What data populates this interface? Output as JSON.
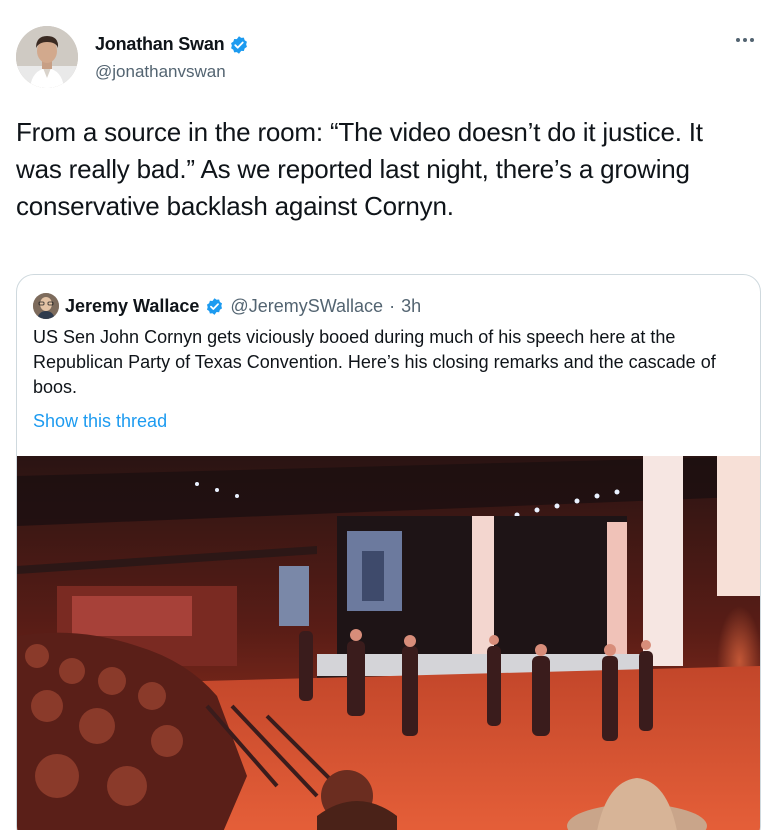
{
  "author": {
    "name": "Jonathan Swan",
    "handle": "@jonathanvswan",
    "verified_color": "#1d9bf0"
  },
  "more_icon": "ellipsis-icon",
  "tweet": {
    "text": "From a source in the room: “The video doesn’t do it justice. It was really bad.” As we reported last night, there’s a growing conservative backlash against Cornyn."
  },
  "quoted_tweet": {
    "author_name": "Jeremy Wallace",
    "handle": "@JeremySWallace",
    "separator": "·",
    "time": "3h",
    "text": "US Sen John Cornyn gets viciously booed during much of his speech here at the Republican Party of Texas Convention. Here’s his closing remarks and the cascade of boos.",
    "show_thread": "Show this thread"
  },
  "colors": {
    "text": "#0f1419",
    "secondary": "#536471",
    "link": "#1d9bf0",
    "border": "#cfd9de"
  }
}
